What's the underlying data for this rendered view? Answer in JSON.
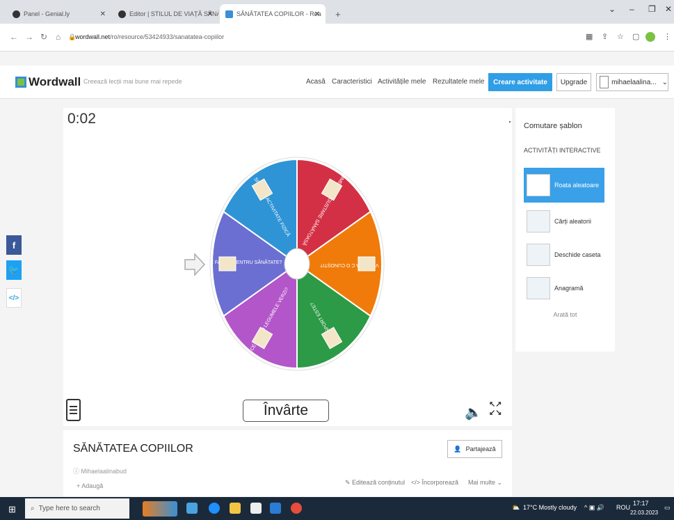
{
  "browser": {
    "tabs": [
      {
        "label": "Panel - Genial.ly",
        "active": false
      },
      {
        "label": "Editor | STILUL DE VIAȚĂ SĂNĂT",
        "active": false
      },
      {
        "label": "SĂNĂTATEA COPIILOR - Roa",
        "active": true
      }
    ],
    "new_tab": "+",
    "url_host": "wordwall.net",
    "url_path": "/ro/resource/53424933/sanatatea-copiilor"
  },
  "header": {
    "logo": "Wordwall",
    "tagline": "Creează lecții mai bune mai repede",
    "nav": [
      "Acasă",
      "Caracteristici",
      "Activitățile mele",
      "Rezultatele mele"
    ],
    "create": "Creare activitate",
    "upgrade": "Upgrade",
    "user": "mihaelaalina...",
    "user_caret": "⌄"
  },
  "activity": {
    "timer": "0:02",
    "spin_label": "Învârte",
    "segments": [
      {
        "label": "NUMEȘTE O GUSTARE SĂNĂTOASĂ",
        "color": "#d33046"
      },
      {
        "label": "VITAMINA C O CUNOȘTI?",
        "color": "#f07b0a"
      },
      {
        "label": "CE SPORT ESTE?",
        "color": "#2c9a46"
      },
      {
        "label": "CE ROL AU LEGUMELE VERZI?",
        "color": "#b356c9"
      },
      {
        "label": "CE FACEM PENTRU SĂNĂTATE?",
        "color": "#6b6fd1"
      },
      {
        "label": "SPUNE O ACTIVITATE FIZICĂ",
        "color": "#2e94d6"
      }
    ]
  },
  "sidebar": {
    "title": "Comutare șablon",
    "subtitle": "ACTIVITĂȚI INTERACTIVE",
    "templates": [
      "Roata aleatoare",
      "Cărți aleatorii",
      "Deschide caseta",
      "Anagramă"
    ],
    "show_all": "Arată tot"
  },
  "info": {
    "title": "SĂNĂTATEA COPIILOR",
    "share": "Partajează",
    "author": "Mihaelaalinabud",
    "add": "+ Adaugă",
    "actions": [
      "Editează conținutul",
      "Încorporează",
      "Mai multe"
    ]
  },
  "taskbar": {
    "search": "Type here to search",
    "weather": "17°C Mostly cloudy",
    "lang": "ROU",
    "time": "17:17",
    "date": "22.03.2023"
  },
  "colors": {
    "accent": "#2f9ee6",
    "facebook": "#3b5998",
    "twitter": "#1da1f2"
  }
}
